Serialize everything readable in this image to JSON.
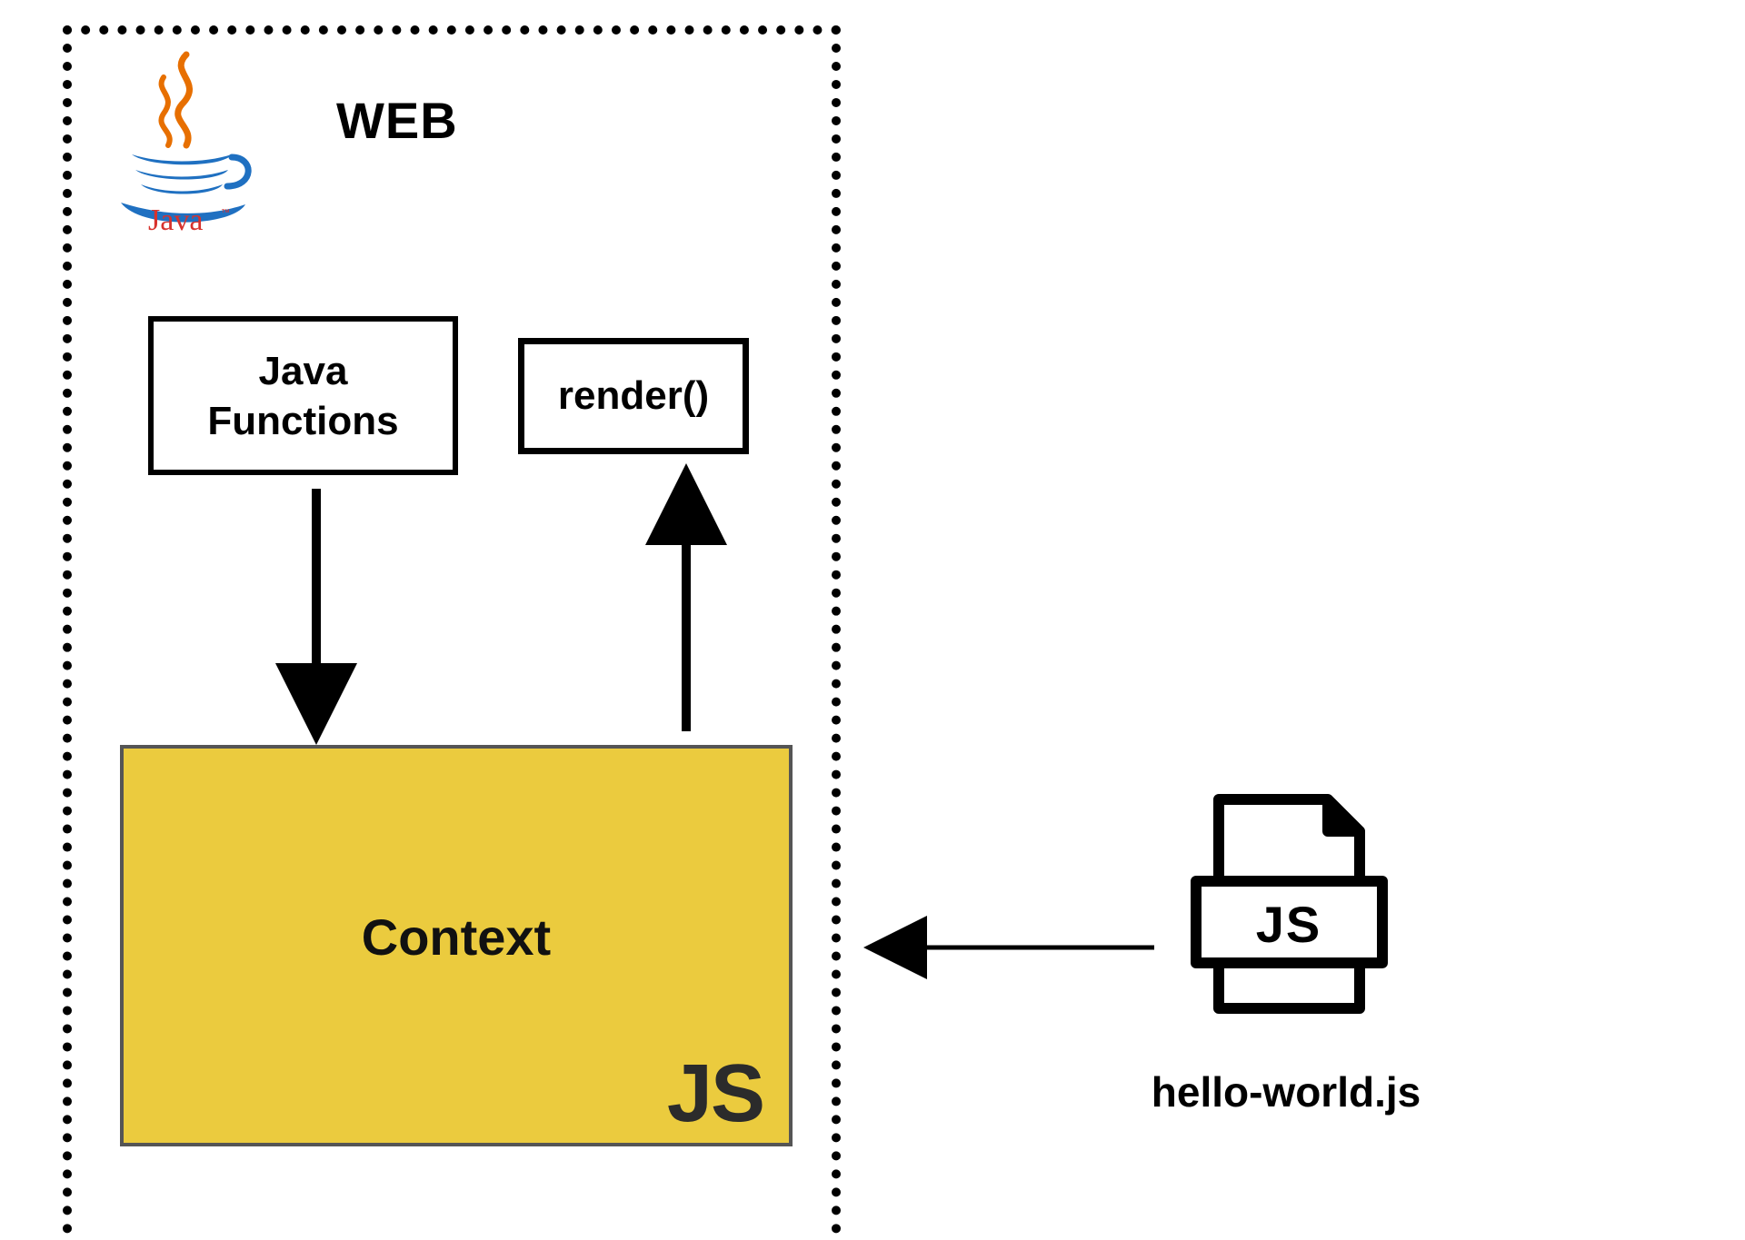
{
  "diagram": {
    "container_title": "WEB",
    "logo_name": "Java",
    "java_functions_label": "Java\nFunctions",
    "render_label": "render()",
    "context_label": "Context",
    "context_badge": "JS",
    "js_file_badge": "JS",
    "js_file_name": "hello-world.js"
  },
  "arrows": [
    {
      "from": "java-functions-box",
      "to": "context-box",
      "direction": "down"
    },
    {
      "from": "context-box",
      "to": "render-box",
      "direction": "up"
    },
    {
      "from": "js-file-icon",
      "to": "context-box",
      "direction": "left"
    }
  ],
  "colors": {
    "context_fill": "#ebcb3e",
    "java_cup_blue": "#1f70c1",
    "java_steam_red": "#e76f00",
    "java_text_red": "#d7322d"
  }
}
